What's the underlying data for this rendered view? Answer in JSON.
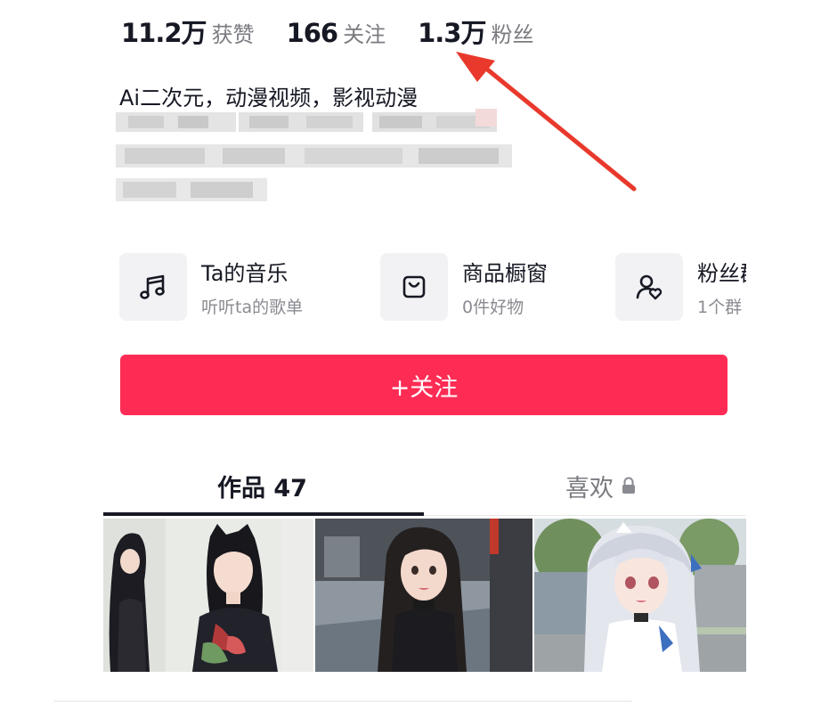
{
  "stats": [
    {
      "value": "11.2万",
      "label": "获赞"
    },
    {
      "value": "166",
      "label": "关注"
    },
    {
      "value": "1.3万",
      "label": "粉丝"
    }
  ],
  "bio": "Ai二次元，动漫视频，影视动漫",
  "shortcuts": [
    {
      "title": "Ta的音乐",
      "subtitle": "听听ta的歌单",
      "icon": "music-note-icon"
    },
    {
      "title": "商品橱窗",
      "subtitle": "0件好物",
      "icon": "shopping-bag-icon"
    },
    {
      "title": "粉丝群",
      "subtitle": "1个群",
      "icon": "fan-group-icon"
    }
  ],
  "follow_button": "+关注",
  "tabs": {
    "works": "作品 47",
    "likes": "喜欢"
  },
  "colors": {
    "accent": "#fe2c55",
    "annotation_arrow": "#e8392c"
  }
}
